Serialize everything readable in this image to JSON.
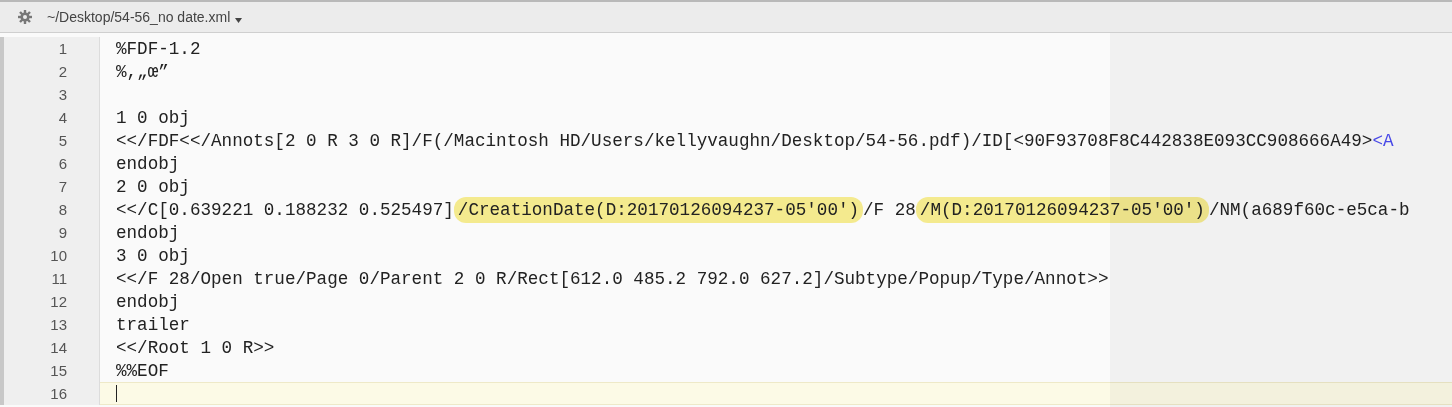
{
  "header": {
    "title": "~/Desktop/54-56_no date.xml"
  },
  "lines": [
    {
      "number": "1",
      "current": false,
      "segments": [
        {
          "kind": "plain",
          "text": "%FDF-1.2"
        }
      ]
    },
    {
      "number": "2",
      "current": false,
      "segments": [
        {
          "kind": "plain",
          "text": "%,„œ”"
        }
      ]
    },
    {
      "number": "3",
      "current": false
    },
    {
      "number": "4",
      "current": false,
      "segments": [
        {
          "kind": "plain",
          "text": "1 0 obj"
        }
      ]
    },
    {
      "number": "5",
      "current": false,
      "segments": [
        {
          "kind": "plain",
          "text": "<</FDF<</Annots[2 0 R 3 0 R]/F(/Macintosh HD/Users/kellyvaughn/Desktop/54-56.pdf)/ID[<90F93708F8C442838E093CC908666A49>"
        },
        {
          "kind": "tag",
          "text": "<A"
        }
      ]
    },
    {
      "number": "6",
      "current": false,
      "segments": [
        {
          "kind": "plain",
          "text": "endobj"
        }
      ]
    },
    {
      "number": "7",
      "current": false,
      "segments": [
        {
          "kind": "plain",
          "text": "2 0 obj"
        }
      ]
    },
    {
      "number": "8",
      "current": false,
      "segments": [
        {
          "kind": "plain",
          "text": "<</C[0.639221 0.188232 0.525497]"
        },
        {
          "kind": "highlight",
          "text": "/CreationDate(D:20170126094237-05'00')"
        },
        {
          "kind": "plain",
          "text": "/F 28"
        },
        {
          "kind": "highlight",
          "text": "/M(D:20170126094237-05'00')"
        },
        {
          "kind": "plain",
          "text": "/NM(a689f60c-e5ca-b"
        }
      ]
    },
    {
      "number": "9",
      "current": false,
      "segments": [
        {
          "kind": "plain",
          "text": "endobj"
        }
      ]
    },
    {
      "number": "10",
      "current": false,
      "segments": [
        {
          "kind": "plain",
          "text": "3 0 obj"
        }
      ]
    },
    {
      "number": "11",
      "current": false,
      "segments": [
        {
          "kind": "plain",
          "text": "<</F 28/Open true/Page 0/Parent 2 0 R/Rect[612.0 485.2 792.0 627.2]/Subtype/Popup/Type/Annot>>"
        }
      ]
    },
    {
      "number": "12",
      "current": false,
      "segments": [
        {
          "kind": "plain",
          "text": "endobj"
        }
      ]
    },
    {
      "number": "13",
      "current": false,
      "segments": [
        {
          "kind": "plain",
          "text": "trailer"
        }
      ]
    },
    {
      "number": "14",
      "current": false,
      "segments": [
        {
          "kind": "plain",
          "text": "<</Root 1 0 R>>"
        }
      ]
    },
    {
      "number": "15",
      "current": false,
      "segments": [
        {
          "kind": "plain",
          "text": "%%EOF"
        }
      ]
    },
    {
      "number": "16",
      "current": true
    }
  ]
}
